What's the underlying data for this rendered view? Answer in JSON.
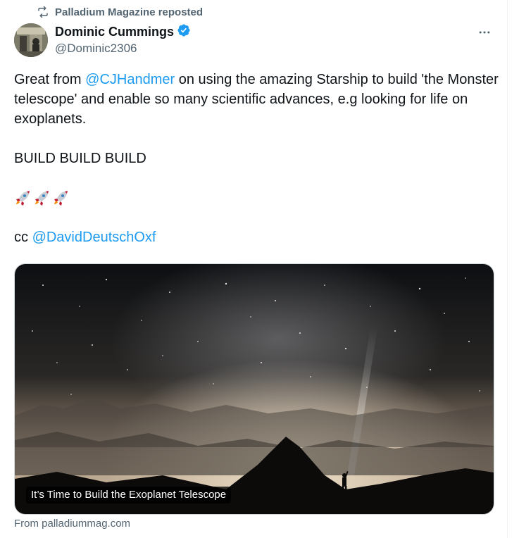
{
  "repost": {
    "label": "Palladium Magazine reposted",
    "icon": "repost-icon"
  },
  "author": {
    "name": "Dominic Cummings",
    "handle": "@Dominic2306",
    "verified": true,
    "verified_color": "#1d9bf0"
  },
  "tweet": {
    "line1_prefix": "Great from ",
    "mention1": "@CJHandmer",
    "line1_suffix": "  on using the amazing Starship to build 'the Monster telescope' and enable so many scientific advances, e.g looking for life on exoplanets.",
    "line2": "BUILD BUILD BUILD",
    "rockets": "🚀🚀🚀",
    "cc_prefix": "cc ",
    "mention2": "@DavidDeutschOxf"
  },
  "card": {
    "caption": "It’s Time to Build the Exoplanet Telescope",
    "source": "From palladiummag.com"
  },
  "colors": {
    "link": "#1d9bf0",
    "secondary_text": "#536471",
    "primary_text": "#0f1419"
  }
}
